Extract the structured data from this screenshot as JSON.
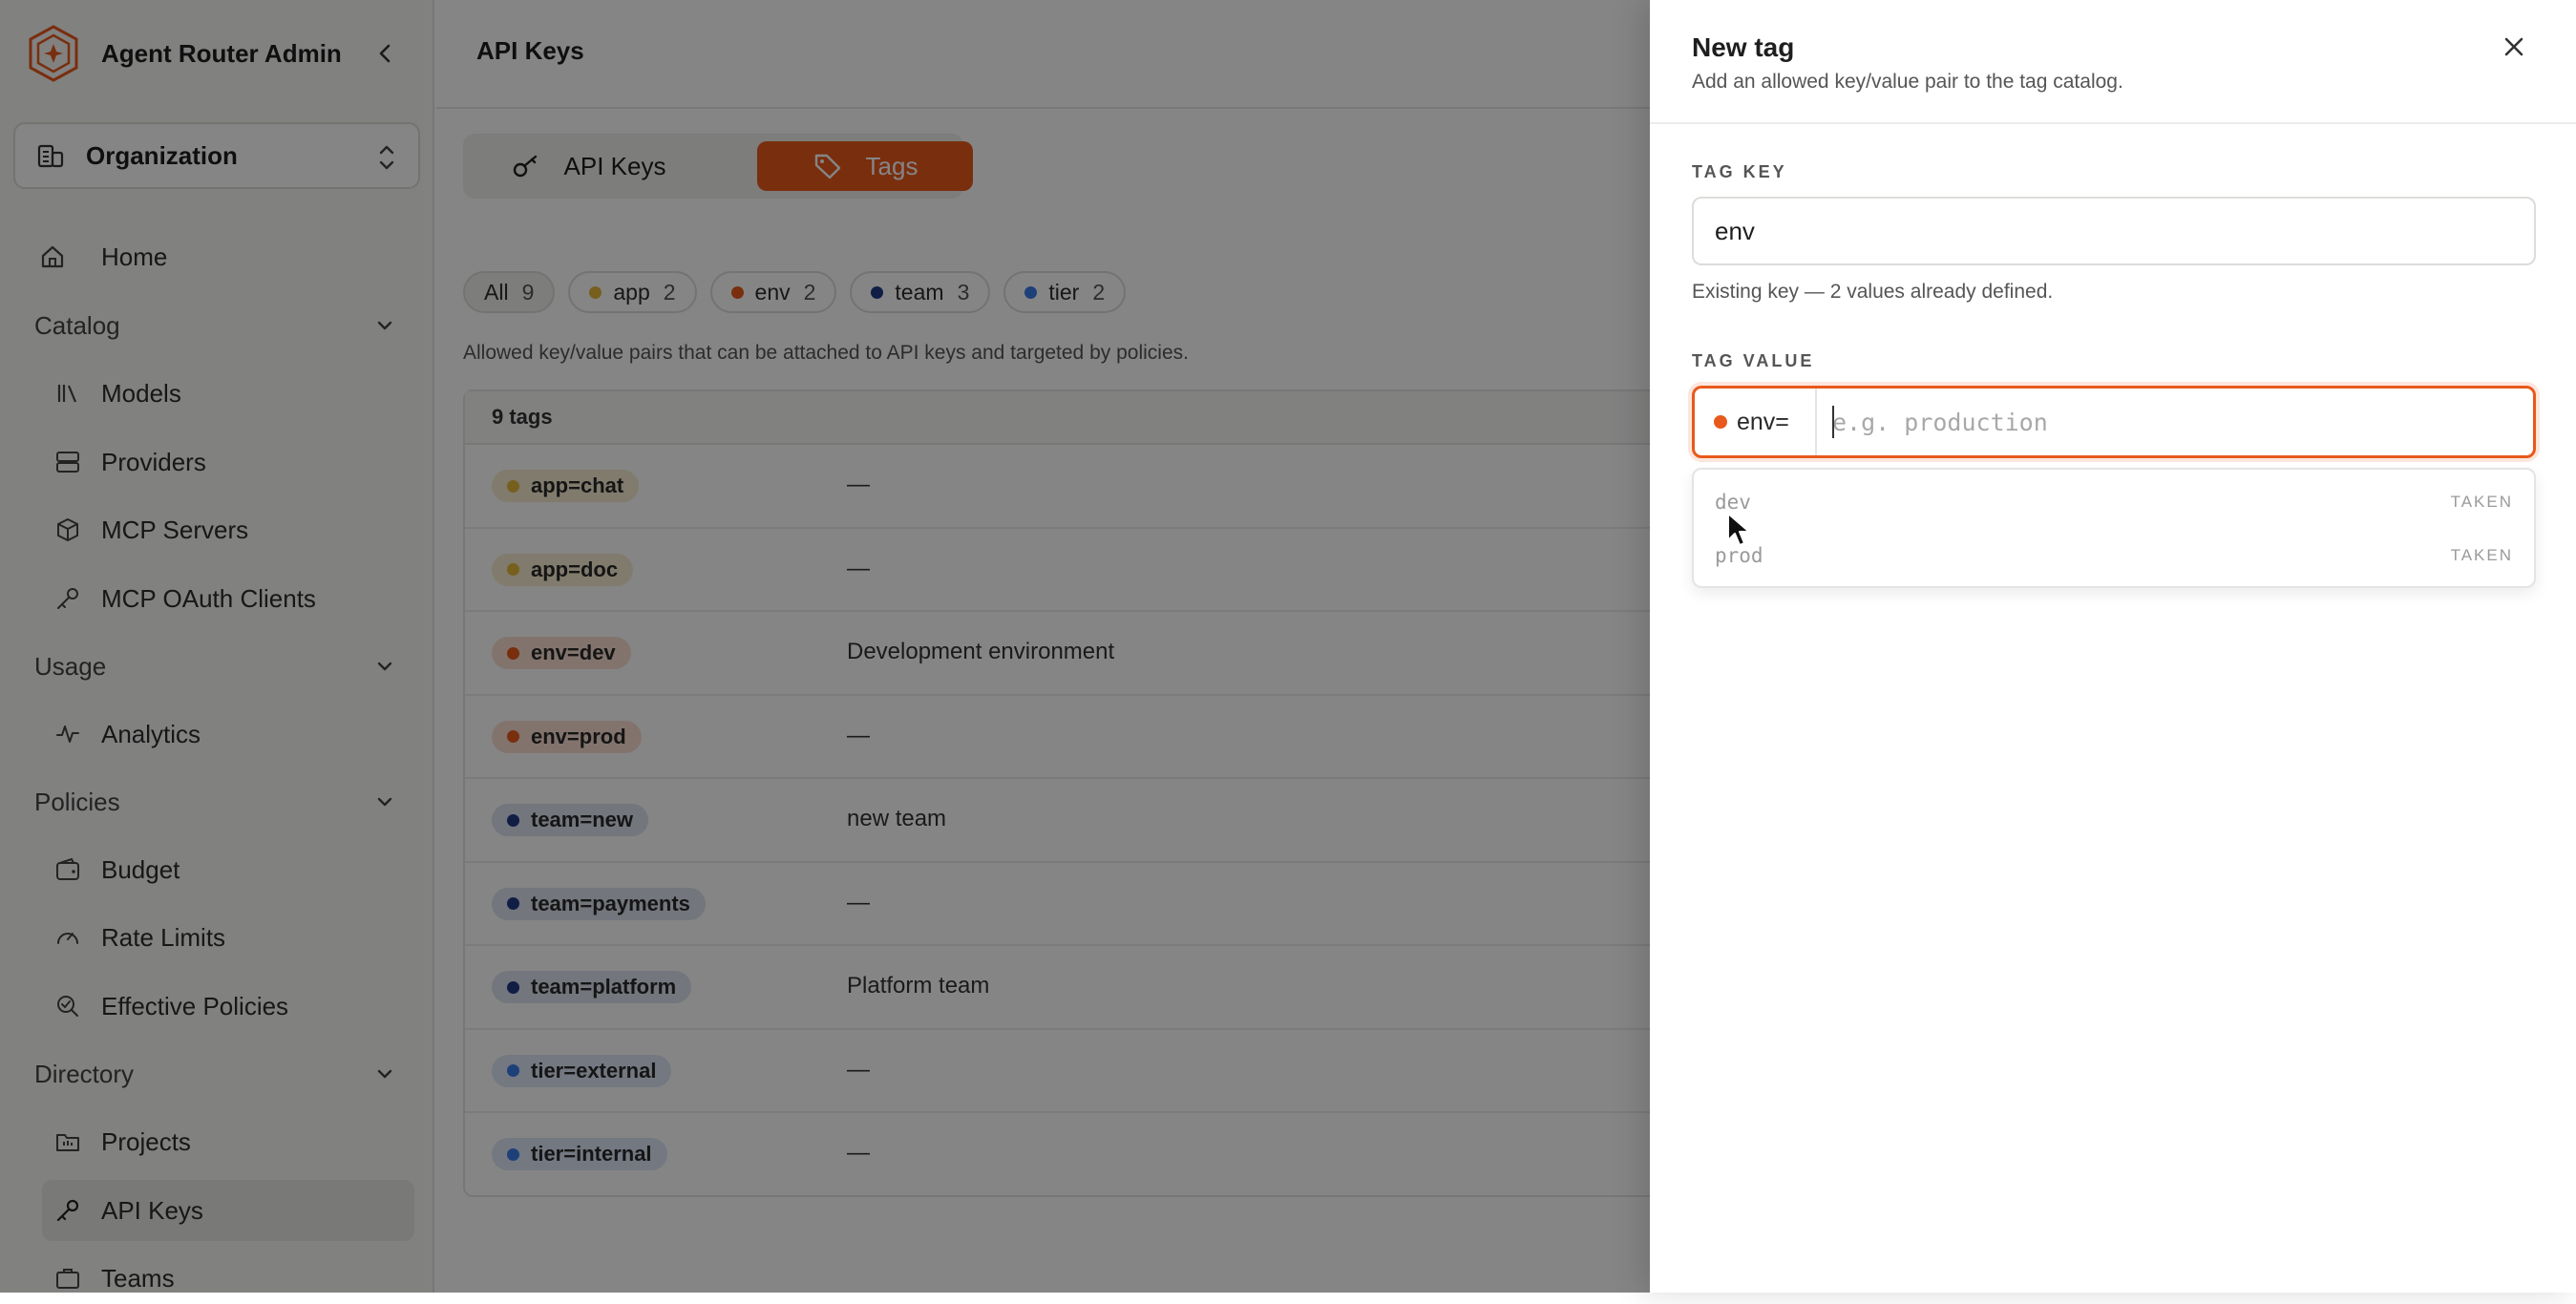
{
  "app": {
    "title": "Agent Router Admin",
    "collapse_icon": "chevron-left-icon"
  },
  "org": {
    "label": "Organization"
  },
  "nav": {
    "home": "Home",
    "catalog": {
      "label": "Catalog",
      "items": [
        "Models",
        "Providers",
        "MCP Servers",
        "MCP OAuth Clients"
      ]
    },
    "usage": {
      "label": "Usage",
      "items": [
        "Analytics"
      ]
    },
    "policies": {
      "label": "Policies",
      "items": [
        "Budget",
        "Rate Limits",
        "Effective Policies"
      ]
    },
    "directory": {
      "label": "Directory",
      "items": [
        "Projects",
        "API Keys",
        "Teams"
      ]
    }
  },
  "page": {
    "title": "API Keys"
  },
  "segments": {
    "keys": "API Keys",
    "tags": "Tags",
    "active": "Tags"
  },
  "chips": [
    {
      "label": "All",
      "count": "9"
    },
    {
      "label": "app",
      "count": "2",
      "color": "#e5b63a"
    },
    {
      "label": "env",
      "count": "2",
      "color": "#e8591c"
    },
    {
      "label": "team",
      "count": "3",
      "color": "#1f3b86"
    },
    {
      "label": "tier",
      "count": "2",
      "color": "#3b7be8"
    }
  ],
  "description": "Allowed key/value pairs that can be attached to API keys and targeted by policies.",
  "table": {
    "count_label": "9 tags",
    "rows": [
      {
        "tag": "app=chat",
        "desc": "—"
      },
      {
        "tag": "app=doc",
        "desc": "—"
      },
      {
        "tag": "env=dev",
        "desc": "Development environment"
      },
      {
        "tag": "env=prod",
        "desc": "—"
      },
      {
        "tag": "team=new",
        "desc": "new team"
      },
      {
        "tag": "team=payments",
        "desc": "—"
      },
      {
        "tag": "team=platform",
        "desc": "Platform team"
      },
      {
        "tag": "tier=external",
        "desc": "—"
      },
      {
        "tag": "tier=internal",
        "desc": "—"
      }
    ]
  },
  "colors": {
    "accent": "#e8591c",
    "app": "#e5b63a",
    "env": "#e8591c",
    "team": "#1f3b86",
    "tier": "#3b7be8"
  },
  "drawer": {
    "title": "New tag",
    "subtitle": "Add an allowed key/value pair to the tag catalog.",
    "key_label": "TAG KEY",
    "key_value": "env",
    "hint": "Existing key — 2 values already defined.",
    "value_label": "TAG VALUE",
    "value_prefix": "env=",
    "value_placeholder": "e.g. production",
    "options": [
      {
        "value": "dev",
        "status": "TAKEN"
      },
      {
        "value": "prod",
        "status": "TAKEN"
      }
    ]
  }
}
